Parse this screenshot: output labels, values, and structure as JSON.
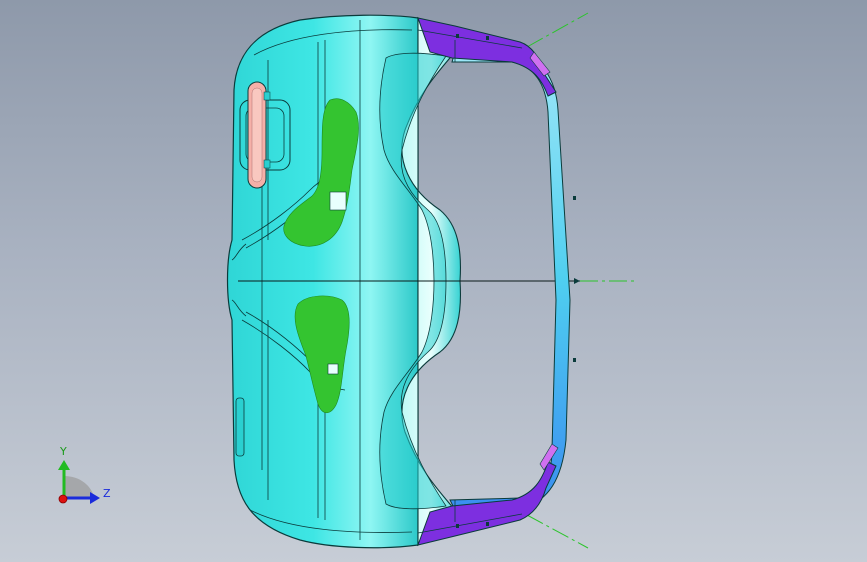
{
  "viewport": {
    "triad": {
      "y_axis_label": "Y",
      "z_axis_label": "Z"
    }
  },
  "colors": {
    "part_surface": "#33e0e0",
    "part_surface_light": "#7ff4f2",
    "part_edge": "#0a3b3b",
    "deviation_green": "#34c430",
    "flange_purple": "#7d2fe0",
    "flange_magenta": "#d070f0",
    "handle_pink": "#f5b0a8",
    "axis_green": "#22bb22",
    "axis_blue": "#1a2bdb",
    "axis_red": "#dd1111",
    "background_top": "#8e99aa",
    "background_bottom": "#c7cdd6"
  },
  "icons": {
    "triad": "view-orientation-triad-icon"
  }
}
